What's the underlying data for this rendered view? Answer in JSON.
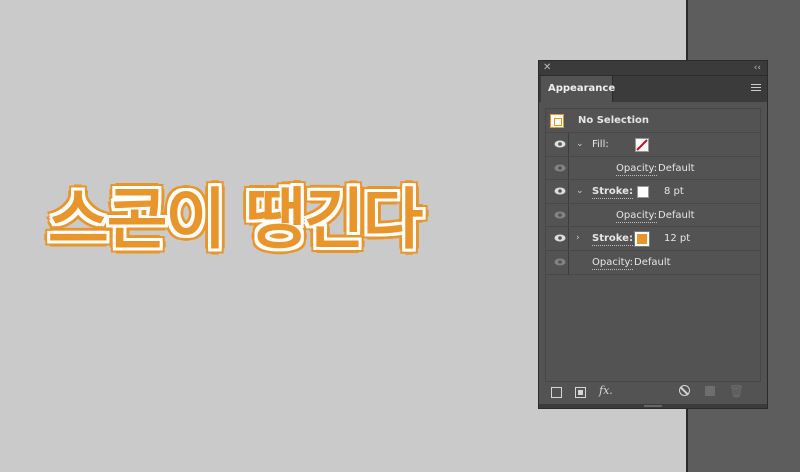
{
  "canvas": {
    "text": "스콘이 땡긴다",
    "colors": {
      "fill": "#e8962b",
      "inner_stroke": "#ffffff",
      "outer_stroke": "#e8962b"
    }
  },
  "panel": {
    "tab_title": "Appearance",
    "selection_label": "No Selection",
    "rows": {
      "fill_label": "Fill:",
      "opacity_label": "Opacity:",
      "opacity_value": "Default",
      "stroke_label": "Stroke:",
      "stroke1_weight": "8 pt",
      "stroke2_weight": "12 pt"
    },
    "icons": {
      "close": "close-icon",
      "collapse": "collapse-icon",
      "menu": "panel-menu-icon",
      "visibility": "eye-icon",
      "expand": "chevron-icon",
      "footer": [
        "add-new-stroke-icon",
        "add-new-fill-icon",
        "add-new-effect-icon",
        "clear-appearance-icon",
        "duplicate-item-icon",
        "delete-item-icon"
      ]
    },
    "colors": {
      "panel_bg": "#535353",
      "fill_swatch": "none-red-slash",
      "stroke1_color": "#ffffff",
      "stroke2_color": "#e8962b"
    }
  }
}
